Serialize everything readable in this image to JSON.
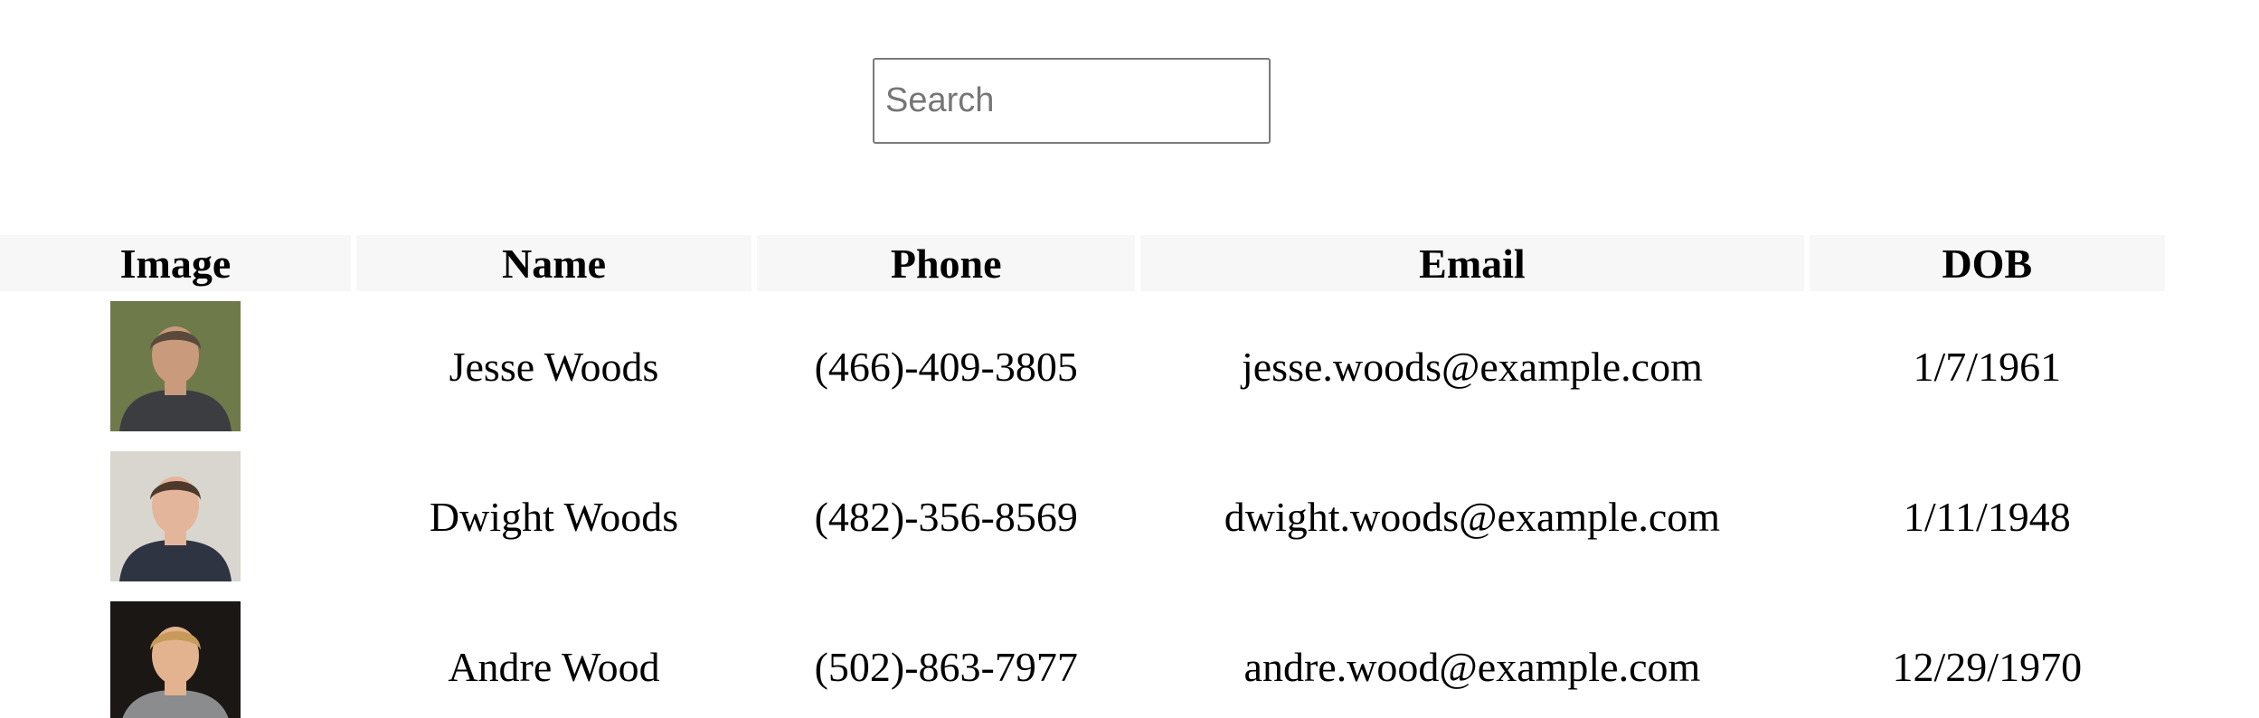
{
  "search": {
    "placeholder": "Search",
    "value": ""
  },
  "table": {
    "headers": {
      "image": "Image",
      "name": "Name",
      "phone": "Phone",
      "email": "Email",
      "dob": "DOB"
    },
    "rows": [
      {
        "name": "Jesse Woods",
        "phone": "(466)-409-3805",
        "email": "jesse.woods@example.com",
        "dob": "1/7/1961",
        "avatar": {
          "bg": "#6f7a4a",
          "skin": "#c99a7c",
          "hair": "#5a4a3c",
          "shirt": "#3b3d40"
        }
      },
      {
        "name": "Dwight Woods",
        "phone": "(482)-356-8569",
        "email": "dwight.woods@example.com",
        "dob": "1/11/1948",
        "avatar": {
          "bg": "#d8d6cf",
          "skin": "#e3b59a",
          "hair": "#4e3a2c",
          "shirt": "#2f3442"
        }
      },
      {
        "name": "Andre Wood",
        "phone": "(502)-863-7977",
        "email": "andre.wood@example.com",
        "dob": "12/29/1970",
        "avatar": {
          "bg": "#1a1714",
          "skin": "#e2b38e",
          "hair": "#c89a5a",
          "shirt": "#8a8c8e"
        }
      }
    ]
  }
}
